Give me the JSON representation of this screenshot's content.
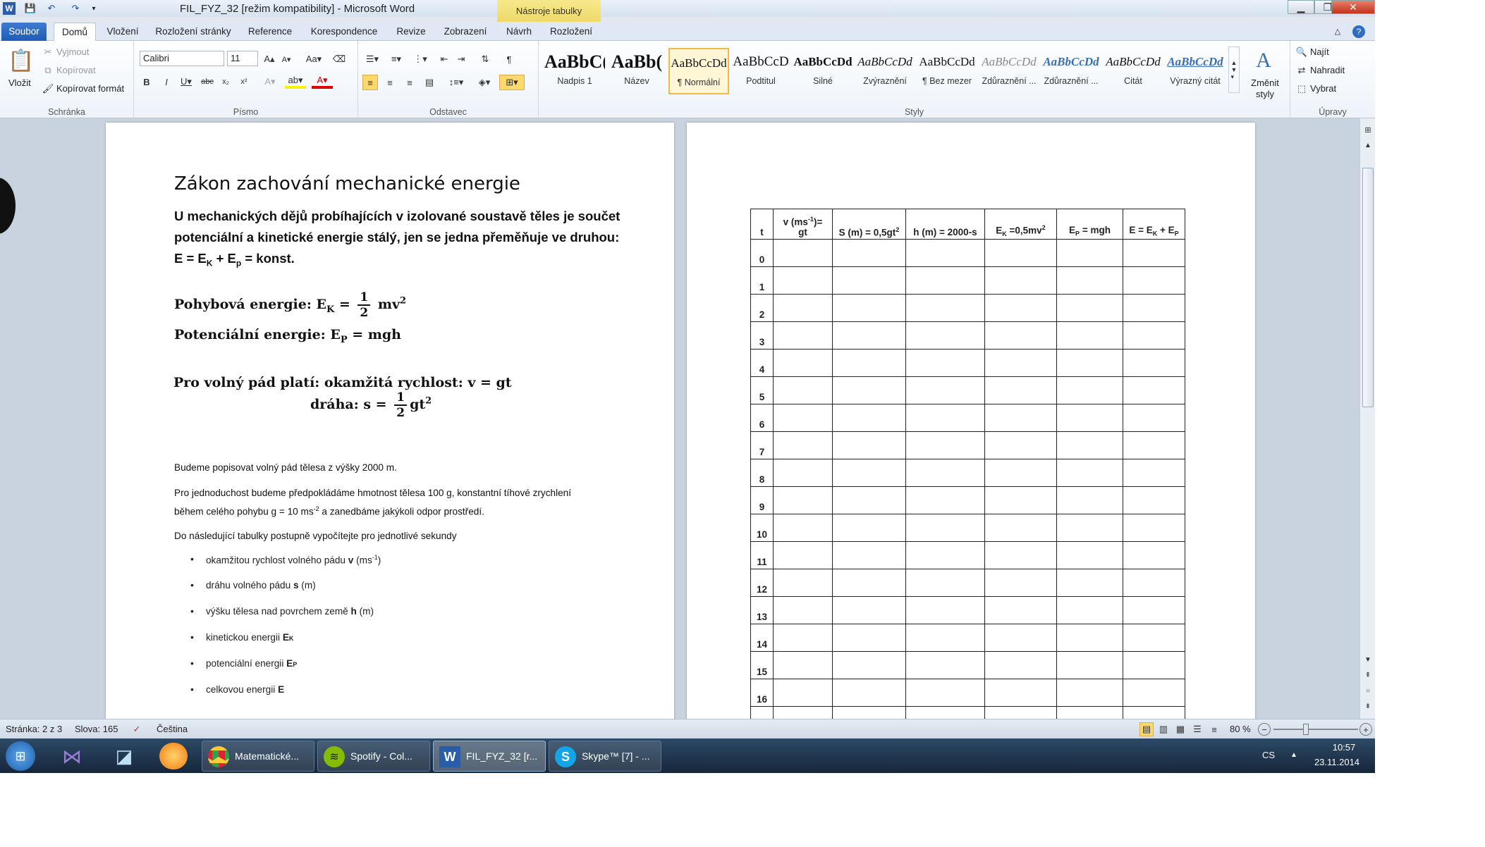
{
  "window": {
    "title": "FIL_FYZ_32 [režim kompatibility] - Microsoft Word",
    "context_tab": "Nástroje tabulky"
  },
  "tabs": [
    "Soubor",
    "Domů",
    "Vložení",
    "Rozložení stránky",
    "Reference",
    "Korespondence",
    "Revize",
    "Zobrazení",
    "Návrh",
    "Rozložení"
  ],
  "ribbon": {
    "clipboard": {
      "paste": "Vložit",
      "cut": "Vyjmout",
      "copy": "Kopírovat",
      "format_painter": "Kopírovat formát",
      "label": "Schránka"
    },
    "font": {
      "name": "Calibri",
      "size": "11",
      "label": "Písmo"
    },
    "paragraph": {
      "label": "Odstavec"
    },
    "styles": {
      "items": [
        {
          "sample": "AaBbC(",
          "name": "Nadpis 1"
        },
        {
          "sample": "AaBb(",
          "name": "Název"
        },
        {
          "sample": "AaBbCcDd",
          "name": "¶ Normální"
        },
        {
          "sample": "AaBbCcD",
          "name": "Podtitul"
        },
        {
          "sample": "AaBbCcDd",
          "name": "Silné"
        },
        {
          "sample": "AaBbCcDd",
          "name": "Zvýraznění"
        },
        {
          "sample": "AaBbCcDd",
          "name": "¶ Bez mezer"
        },
        {
          "sample": "AaBbCcDd",
          "name": "Zdůraznění ..."
        },
        {
          "sample": "AaBbCcDd",
          "name": "Zdůraznění ..."
        },
        {
          "sample": "AaBbCcDd",
          "name": "Citát"
        },
        {
          "sample": "AaBbCcDd",
          "name": "Výrazný citát"
        }
      ],
      "change": "Změnit styly",
      "label": "Styly"
    },
    "editing": {
      "find": "Najít",
      "replace": "Nahradit",
      "select": "Vybrat",
      "label": "Úpravy"
    }
  },
  "document": {
    "title": "Zákon zachování mechanické energie",
    "intro_1": "U mechanických dějů probíhajících  v izolované  soustavě těles je součet potenciální  a kinetické energie stálý, jen se jedna přeměňuje ve druhou:  E = E",
    "intro_sub_k": "K",
    "intro_plus": " + E",
    "intro_sub_p": "p",
    "intro_end": " = konst.",
    "kin_label": "Pohybová energie",
    "kin_lhs": ": E",
    "kin_sub": "K",
    "kin_eq": " = ",
    "kin_rest": " mv",
    "pot_label": "Potenciální energie",
    "pot_formula": ": E",
    "pot_sub": "P",
    "pot_rest": " = mgh",
    "fall_label": "Pro volný pád platí:  okamžitá rychlost",
    "fall_formula": ": v = gt",
    "path_label": "dráha",
    "path_formula": ": s = ",
    "path_rest": "gt",
    "frac_num": "1",
    "frac_den": "2",
    "sup2": "2",
    "para1": "Budeme popisovat  volný pád tělesa z výšky 2000 m.",
    "para2a": "Pro jednoduchost  budeme předpokládáme hmotnost  tělesa 100 g, konstantní  tíhové zrychlení během celého pohybu  g = 10 ms",
    "para2_sup": "-2",
    "para2b": " a zanedbáme jakýkoli odpor  prostředí.",
    "para3": "Do následující tabulky postupně vypočítejte pro jednotlivé sekundy",
    "bullets": [
      {
        "text": "okamžitou rychlost volného pádu ",
        "bold": "v",
        "tail": " (ms",
        "sup": "-1",
        "end": ")"
      },
      {
        "text": "dráhu volného pádu ",
        "bold": "s",
        "tail": " (m)",
        "sup": "",
        "end": ""
      },
      {
        "text": "výšku tělesa nad povrchem země ",
        "bold": "h",
        "tail": " (m)",
        "sup": "",
        "end": ""
      },
      {
        "text": "kinetickou energii ",
        "bold": "E",
        "tail": "",
        "sup": "",
        "end": "K"
      },
      {
        "text": "potenciální energii ",
        "bold": "E",
        "tail": "",
        "sup": "",
        "end": "P"
      },
      {
        "text": "celkovou energii ",
        "bold": "E",
        "tail": "",
        "sup": "",
        "end": ""
      }
    ],
    "table": {
      "headers": [
        "t",
        "v (ms-1)= gt",
        "S (m) = 0,5gt2",
        "h (m) = 2000-s",
        "EK =0,5mv2",
        "EP = mgh",
        "E = EK + EP"
      ],
      "rows": [
        "0",
        "1",
        "2",
        "3",
        "4",
        "5",
        "6",
        "7",
        "8",
        "9",
        "10",
        "11",
        "12",
        "13",
        "14",
        "15",
        "16",
        ""
      ]
    }
  },
  "status": {
    "page": "Stránka: 2 z 3",
    "words": "Slova: 165",
    "language": "Čeština",
    "zoom": "80 %"
  },
  "taskbar": {
    "apps": [
      {
        "label": "Matematické..."
      },
      {
        "label": "Spotify - Col..."
      },
      {
        "label": "FIL_FYZ_32 [r..."
      },
      {
        "label": "Skype™ [7] - ..."
      }
    ],
    "lang": "CS",
    "time": "10:57",
    "date": "23.11.2014"
  }
}
